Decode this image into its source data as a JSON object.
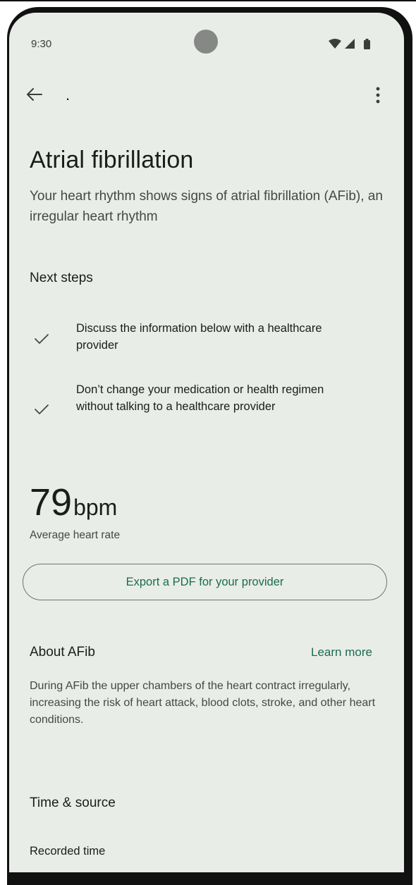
{
  "status_bar": {
    "time": "9:30",
    "icons": [
      "wifi-icon",
      "cellular-signal-icon",
      "battery-icon"
    ]
  },
  "app_bar": {
    "back_icon": "arrow-back-icon",
    "title": ".",
    "menu_icon": "more-vert-icon"
  },
  "header": {
    "title": "Atrial fibrillation",
    "subtitle": "Your heart rhythm shows signs of atrial fibrillation (AFib), an irregular heart rhythm"
  },
  "next_steps": {
    "heading": "Next steps",
    "items": [
      {
        "icon": "check-icon",
        "text": "Discuss the information below with a healthcare provider"
      },
      {
        "icon": "check-icon",
        "text": "Don’t change your medication or health regimen without talking to a healthcare provider"
      }
    ]
  },
  "heart_rate": {
    "value": "79",
    "unit": "bpm",
    "caption": "Average heart rate"
  },
  "export_button": {
    "label": "Export a PDF for your provider"
  },
  "about": {
    "heading": "About AFib",
    "link": "Learn more",
    "text": "During AFib the upper chambers of the heart contract irregularly, increasing the risk of heart attack, blood clots, stroke, and other heart conditions."
  },
  "time_source": {
    "heading": "Time & source",
    "recorded_label": "Recorded time"
  },
  "colors": {
    "background": "#e8ede8",
    "accent": "#1c6b53",
    "text_primary": "#1b1d1b",
    "text_secondary": "#454845"
  }
}
